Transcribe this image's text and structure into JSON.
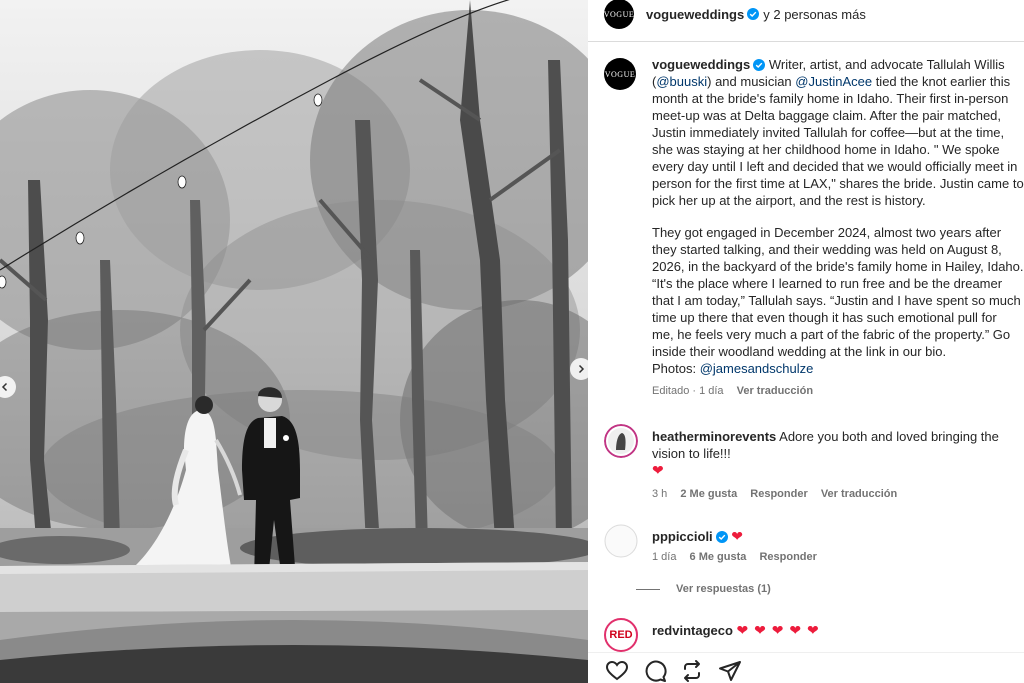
{
  "header": {
    "username": "vogueweddings",
    "others": "y 2 personas más",
    "avatar_text": "VOGUE"
  },
  "caption": {
    "username": "vogueweddings",
    "lines1": [
      [
        " Writer, artist, and advocate Tallulah Willis"
      ],
      [
        "(",
        "@buuski",
        ") and musician ",
        "@JustinAcee",
        " tied the knot earlier this"
      ],
      [
        "month at the bride's family home in Idaho. Their first in-person"
      ],
      [
        "meet-up was at Delta baggage claim. After the pair matched,"
      ],
      [
        "Justin immediately invited Tallulah for coffee—but at the time,"
      ],
      [
        "she was staying at her childhood home in Idaho. \" We spoke"
      ],
      [
        "every day until I left and decided that we would officially meet in"
      ],
      [
        "person for the first time at LAX,\" shares the bride. Justin came to"
      ],
      [
        "pick her up at the airport, and the rest is history."
      ]
    ],
    "lines2": [
      "They got engaged in December 2024, almost two years after",
      "they started talking, and their wedding was held on August 8,",
      "2026, in the backyard of the bride's family home in Hailey, Idaho.",
      "“It's the place where I learned to run free and be the dreamer",
      "that I am today,” Tallulah says. “Justin and I have spent so much",
      "time up there that even though it has such emotional pull for",
      "me, he feels very much a part of the fabric of the property.” Go",
      "inside their woodland wedding at the link in our bio."
    ],
    "photos_label": "Photos: ",
    "photos_mention": "@jamesandschulze",
    "edited": "Editado · 1 día",
    "see_translation": "Ver traducción"
  },
  "comments": [
    {
      "username": "heatherminorevents",
      "text_line1": " Adore you both and loved bringing the",
      "text_line2": "vision to life!!!",
      "hearts": "❤",
      "time": "3 h",
      "likes": "2 Me gusta",
      "reply": "Responder",
      "translation": "Ver traducción"
    },
    {
      "username": "pppiccioli",
      "hearts": "❤",
      "time": "1 día",
      "likes": "6 Me gusta",
      "reply": "Responder",
      "view_replies": "Ver respuestas (1)"
    },
    {
      "username": "redvintageco",
      "hearts": "❤ ❤ ❤ ❤ ❤",
      "avatar_text": "RED"
    }
  ],
  "icons": [
    "heart-icon",
    "comment-icon",
    "share-icon",
    "send-icon",
    "verified-icon",
    "chevron-left-icon",
    "chevron-right-icon"
  ],
  "colors": {
    "link": "#00376b",
    "verified": "#0095f6",
    "heart": "#ed1c3c",
    "muted": "#737373"
  }
}
